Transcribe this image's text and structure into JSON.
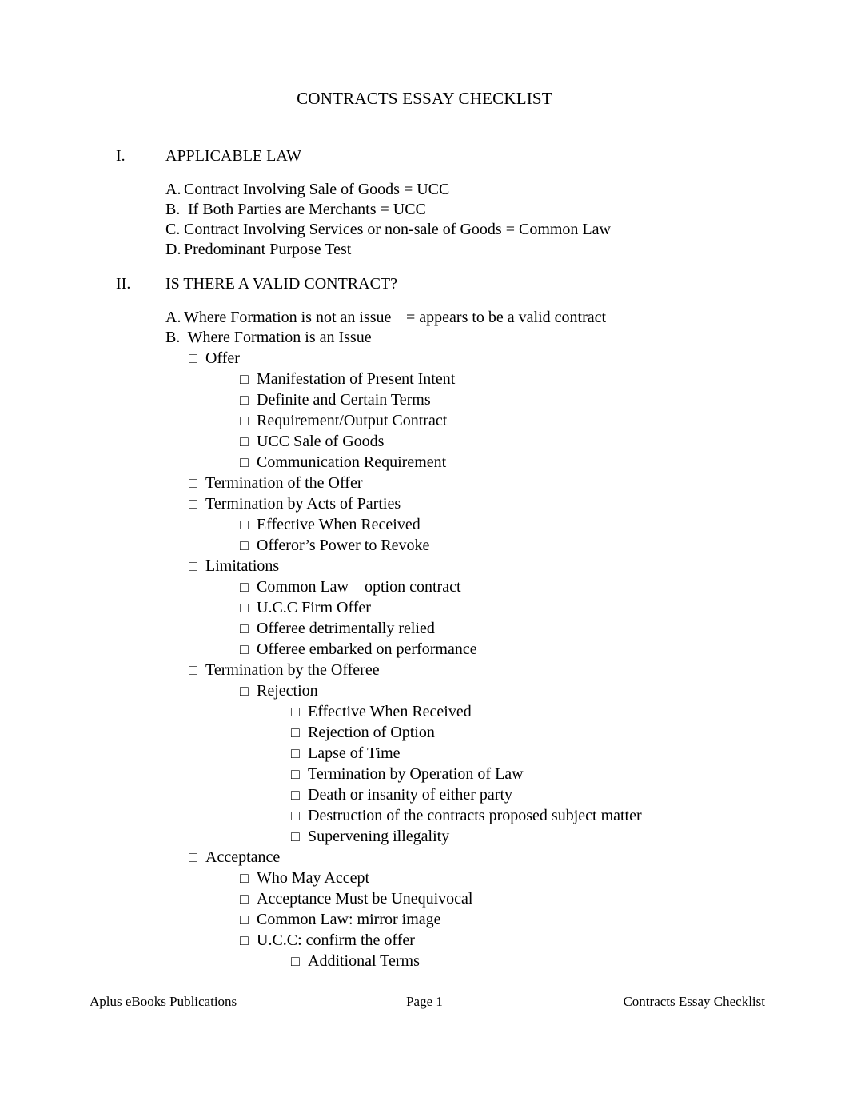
{
  "document": {
    "title": "CONTRACTS ESSAY CHECKLIST"
  },
  "sections": [
    {
      "numeral": "I.",
      "title": "APPLICABLE LAW",
      "lettered": [
        {
          "letter": "A.",
          "text": "Contract Involving Sale of Goods = UCC",
          "note": ""
        },
        {
          "letter": "B.",
          "text": " If Both Parties are Merchants = UCC",
          "note": ""
        },
        {
          "letter": "C.",
          "text": "Contract Involving Services or non-sale of Goods = Common Law",
          "note": ""
        },
        {
          "letter": "D.",
          "text": "Predominant Purpose Test",
          "note": ""
        }
      ]
    },
    {
      "numeral": "II.",
      "title": "IS THERE A VALID CONTRACT?",
      "lettered": [
        {
          "letter": "A.",
          "text": "Where Formation is not an issue",
          "note": "= appears to be a valid contract"
        },
        {
          "letter": "B.",
          "text": " Where Formation is an Issue",
          "note": ""
        }
      ]
    }
  ],
  "checklist": [
    {
      "level": 1,
      "text": "Offer"
    },
    {
      "level": 2,
      "text": "Manifestation of Present Intent"
    },
    {
      "level": 2,
      "text": "Definite and Certain Terms"
    },
    {
      "level": 2,
      "text": "Requirement/Output Contract"
    },
    {
      "level": 2,
      "text": "UCC Sale of Goods"
    },
    {
      "level": 2,
      "text": "Communication Requirement"
    },
    {
      "level": 1,
      "text": "Termination of the Offer"
    },
    {
      "level": 1,
      "text": "Termination by Acts of Parties"
    },
    {
      "level": 2,
      "text": "Effective When Received"
    },
    {
      "level": 2,
      "text": "Offeror’s Power to Revoke"
    },
    {
      "level": 1,
      "text": "Limitations"
    },
    {
      "level": 2,
      "text": "Common Law – option contract"
    },
    {
      "level": 2,
      "text": "U.C.C Firm Offer"
    },
    {
      "level": 2,
      "text": "Offeree detrimentally relied"
    },
    {
      "level": 2,
      "text": "Offeree embarked on performance"
    },
    {
      "level": 1,
      "text": "Termination by the Offeree"
    },
    {
      "level": 2,
      "text": "Rejection"
    },
    {
      "level": 3,
      "text": "Effective When Received"
    },
    {
      "level": 3,
      "text": "Rejection of Option"
    },
    {
      "level": 3,
      "text": "Lapse of Time"
    },
    {
      "level": 3,
      "text": "Termination by Operation of Law"
    },
    {
      "level": 3,
      "text": "Death or insanity of either party"
    },
    {
      "level": 3,
      "text": "Destruction of the contracts proposed subject matter"
    },
    {
      "level": 3,
      "text": "Supervening illegality"
    },
    {
      "level": 1,
      "text": "Acceptance"
    },
    {
      "level": 2,
      "text": "Who May Accept"
    },
    {
      "level": 2,
      "text": "Acceptance Must be Unequivocal"
    },
    {
      "level": 2,
      "text": "Common Law: mirror image"
    },
    {
      "level": 2,
      "text": "U.C.C: confirm the offer"
    },
    {
      "level": 3,
      "text": "Additional Terms"
    }
  ],
  "checkbox_glyph": "□",
  "footer": {
    "left": "Aplus eBooks Publications",
    "center": "Page 1",
    "right": "Contracts Essay Checklist"
  }
}
